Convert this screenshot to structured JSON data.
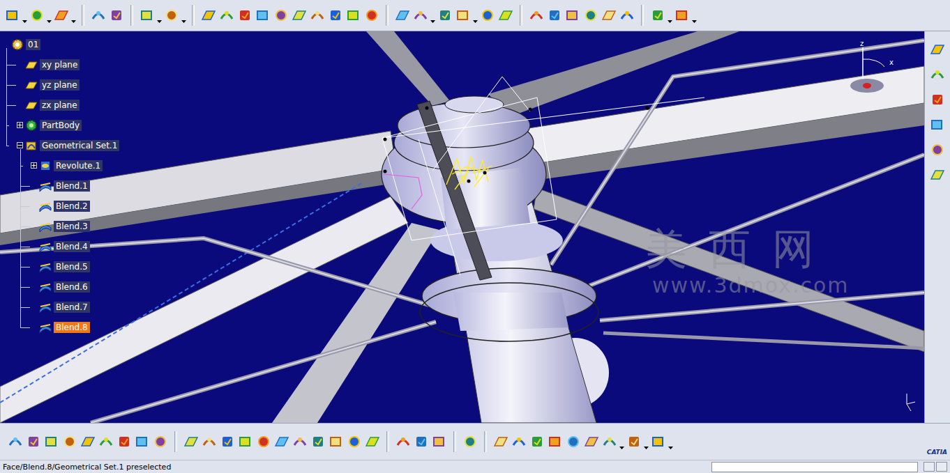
{
  "tree": {
    "items": [
      {
        "label": "01",
        "kind": "root",
        "depth": 0,
        "expandable": false,
        "expanded": true,
        "selected": false
      },
      {
        "label": "xy plane",
        "kind": "plane",
        "depth": 1,
        "expandable": false,
        "expanded": false,
        "selected": false
      },
      {
        "label": "yz plane",
        "kind": "plane",
        "depth": 1,
        "expandable": false,
        "expanded": false,
        "selected": false
      },
      {
        "label": "zx plane",
        "kind": "plane",
        "depth": 1,
        "expandable": false,
        "expanded": false,
        "selected": false
      },
      {
        "label": "PartBody",
        "kind": "body",
        "depth": 1,
        "expandable": true,
        "expanded": false,
        "selected": false
      },
      {
        "label": "Geometrical Set.1",
        "kind": "set",
        "depth": 1,
        "expandable": true,
        "expanded": true,
        "selected": false
      },
      {
        "label": "Revolute.1",
        "kind": "revolute",
        "depth": 2,
        "expandable": true,
        "expanded": false,
        "selected": false
      },
      {
        "label": "Blend.1",
        "kind": "blend",
        "depth": 2,
        "expandable": false,
        "expanded": false,
        "selected": false
      },
      {
        "label": "Blend.2",
        "kind": "blend",
        "depth": 2,
        "expandable": false,
        "expanded": false,
        "selected": false
      },
      {
        "label": "Blend.3",
        "kind": "blend",
        "depth": 2,
        "expandable": false,
        "expanded": false,
        "selected": false
      },
      {
        "label": "Blend.4",
        "kind": "blend",
        "depth": 2,
        "expandable": false,
        "expanded": false,
        "selected": false
      },
      {
        "label": "Blend.5",
        "kind": "blend",
        "depth": 2,
        "expandable": false,
        "expanded": false,
        "selected": false
      },
      {
        "label": "Blend.6",
        "kind": "blend",
        "depth": 2,
        "expandable": false,
        "expanded": false,
        "selected": false
      },
      {
        "label": "Blend.7",
        "kind": "blend",
        "depth": 2,
        "expandable": false,
        "expanded": false,
        "selected": false
      },
      {
        "label": "Blend.8",
        "kind": "blend",
        "depth": 2,
        "expandable": false,
        "expanded": false,
        "selected": true
      }
    ]
  },
  "viewport": {
    "watermark": {
      "title": "美 西 网",
      "url": "www.3dmox.com"
    },
    "compass": {
      "z": "z",
      "x": "x"
    }
  },
  "logo": {
    "text": "CATIA"
  },
  "status_bar": {
    "text": "Face/Blend.8/Geometrical Set.1 preselected"
  }
}
